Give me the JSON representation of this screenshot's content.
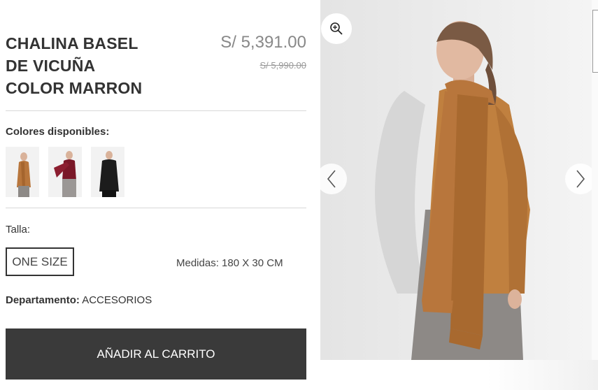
{
  "product": {
    "title_lines": [
      "CHALINA BASEL",
      "DE VICUÑA",
      "COLOR MARRON"
    ],
    "price": "S/ 5,391.00",
    "old_price": "S/ 5,990.00"
  },
  "colors": {
    "label": "Colores disponibles:",
    "swatches": [
      {
        "name": "marron",
        "color": "#b8763c"
      },
      {
        "name": "granate",
        "color": "#7a1828"
      },
      {
        "name": "negro",
        "color": "#1c1c1c"
      }
    ]
  },
  "size": {
    "label": "Talla:",
    "option": "ONE SIZE",
    "measures_label": "Medidas:",
    "measures_value": "180 X 30 CM"
  },
  "department": {
    "label": "Departamento:",
    "value": "ACCESORIOS"
  },
  "cart": {
    "button_label": "AÑADIR AL CARRITO"
  },
  "gallery": {
    "zoom_icon": "zoom-in-icon",
    "prev_icon": "chevron-left-icon",
    "next_icon": "chevron-right-icon",
    "scarf_color": "#b8763c",
    "skirt_color": "#8d8986"
  }
}
